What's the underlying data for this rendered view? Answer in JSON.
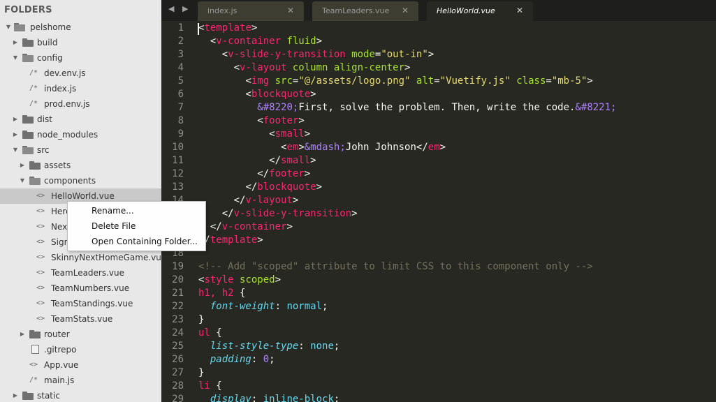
{
  "sidebar": {
    "header": "FOLDERS",
    "tree": {
      "pelshome": "pelshome",
      "build": "build",
      "config": "config",
      "dev_env": "dev.env.js",
      "index_js": "index.js",
      "prod_env": "prod.env.js",
      "dist": "dist",
      "node_modules": "node_modules",
      "src": "src",
      "assets": "assets",
      "components": "components",
      "helloworld": "HelloWorld.vue",
      "hero": "Hero",
      "next": "Next",
      "sign": "Sign",
      "skinny": "SkinnyNextHomeGame.vue",
      "teamleaders": "TeamLeaders.vue",
      "teamnumbers": "TeamNumbers.vue",
      "teamstandings": "TeamStandings.vue",
      "teamstats": "TeamStats.vue",
      "router": "router",
      "gitrepo": ".gitrepo",
      "appvue": "App.vue",
      "mainjs": "main.js",
      "static": "static"
    },
    "glyphs": {
      "vue": "<>",
      "js": "/*"
    }
  },
  "context_menu": {
    "items": [
      "Rename...",
      "Delete File",
      "Open Containing Folder..."
    ]
  },
  "tabs": {
    "nav_arrows": "◀ ▶",
    "close_glyph": "✕",
    "items": [
      {
        "label": "index.js",
        "active": false
      },
      {
        "label": "TeamLeaders.vue",
        "active": false
      },
      {
        "label": "HelloWorld.vue",
        "active": true
      }
    ]
  },
  "editor": {
    "line_numbers": [
      "1",
      "2",
      "3",
      "4",
      "5",
      "6",
      "7",
      "8",
      "9",
      "10",
      "11",
      "12",
      "13",
      "14",
      "15",
      "16",
      "17",
      "18",
      "19",
      "20",
      "21",
      "22",
      "23",
      "24",
      "25",
      "26",
      "27",
      "28",
      "29"
    ],
    "code": {
      "l1": {
        "open": "<",
        "tag": "template",
        "close": ">"
      },
      "l2": {
        "indent": "  ",
        "open": "<",
        "tag": "v-container",
        "attr": " fluid",
        "close": ">"
      },
      "l3": {
        "indent": "    ",
        "open": "<",
        "tag": "v-slide-y-transition",
        "attr": " mode",
        "eq": "=",
        "str": "\"out-in\"",
        "close": ">"
      },
      "l4": {
        "indent": "      ",
        "open": "<",
        "tag": "v-layout",
        "attr": " column align-center",
        "close": ">"
      },
      "l5": {
        "indent": "        ",
        "open": "<",
        "tag": "img",
        "a1": " src",
        "eq1": "=",
        "s1": "\"@/assets/logo.png\"",
        "a2": " alt",
        "eq2": "=",
        "s2": "\"Vuetify.js\"",
        "a3": " class",
        "eq3": "=",
        "s3": "\"mb-5\"",
        "close": ">"
      },
      "l6": {
        "indent": "        ",
        "open": "<",
        "tag": "blockquote",
        "close": ">"
      },
      "l7": {
        "indent": "          ",
        "e1": "&#8220;",
        "text": "First, solve the problem. Then, write the code.",
        "e2": "&#8221;"
      },
      "l8": {
        "indent": "          ",
        "open": "<",
        "tag": "footer",
        "close": ">"
      },
      "l9": {
        "indent": "            ",
        "open": "<",
        "tag": "small",
        "close": ">"
      },
      "l10": {
        "indent": "              ",
        "open": "<",
        "tag": "em",
        "close": ">",
        "ent": "&mdash;",
        "text": "John Johnson",
        "copen": "</",
        "ctag": "em",
        "cclose": ">"
      },
      "l11": {
        "indent": "            ",
        "open": "</",
        "tag": "small",
        "close": ">"
      },
      "l12": {
        "indent": "          ",
        "open": "</",
        "tag": "footer",
        "close": ">"
      },
      "l13": {
        "indent": "        ",
        "open": "</",
        "tag": "blockquote",
        "close": ">"
      },
      "l14": {
        "indent": "      ",
        "open": "</",
        "tag": "v-layout",
        "close": ">"
      },
      "l15": {
        "indent": "    ",
        "open": "</",
        "tag": "v-slide-y-transition",
        "close": ">"
      },
      "l16": {
        "indent": "  ",
        "open": "</",
        "tag": "v-container",
        "close": ">"
      },
      "l17": {
        "open": "</",
        "tag": "template",
        "close": ">"
      },
      "l18": {
        "text": ""
      },
      "l19": {
        "comment": "<!-- Add \"scoped\" attribute to limit CSS to this component only -->"
      },
      "l20": {
        "open": "<",
        "tag": "style",
        "attr": " scoped",
        "close": ">"
      },
      "l21": {
        "sel": "h1, h2",
        "brace": " {"
      },
      "l22": {
        "indent": "  ",
        "prop": "font-weight",
        "colon": ": ",
        "val": "normal",
        "semi": ";"
      },
      "l23": {
        "brace": "}"
      },
      "l24": {
        "sel": "ul",
        "brace": " {"
      },
      "l25": {
        "indent": "  ",
        "prop": "list-style-type",
        "colon": ": ",
        "val": "none",
        "semi": ";"
      },
      "l26": {
        "indent": "  ",
        "prop": "padding",
        "colon": ": ",
        "val": "0",
        "semi": ";"
      },
      "l27": {
        "brace": "}"
      },
      "l28": {
        "sel": "li",
        "brace": " {"
      },
      "l29": {
        "indent": "  ",
        "prop": "display",
        "colon": ": ",
        "val": "inline-block",
        "semi": ";"
      }
    }
  }
}
